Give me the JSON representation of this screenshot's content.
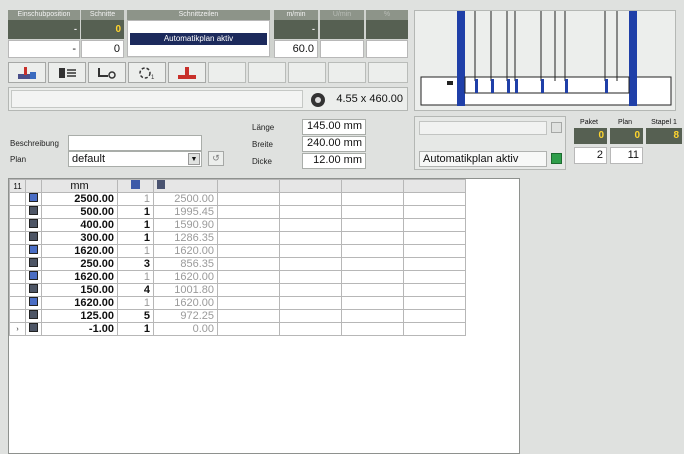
{
  "top_panel": {
    "headers": {
      "einschubposition": "Einschubposition",
      "schnitte": "Schnitte",
      "schnittzeilen": "Schnittzeilen",
      "m_min": "m/min",
      "u_min": "U/min",
      "percent": "%"
    },
    "row1": {
      "einschub": "-",
      "schnitte": "0",
      "schnittzeilen_status": "Automatikplan aktiv",
      "m_min": "-"
    },
    "row2": {
      "einschub": "-",
      "schnitte": "0",
      "m_min": "60.0"
    }
  },
  "toolbar": {
    "buttons": [
      "cut-saw-icon",
      "stack-icon",
      "pusher-icon",
      "rotate-icon",
      "saw-blade-icon"
    ]
  },
  "status_bar": {
    "dimension": "4.55 x 460.00"
  },
  "form": {
    "beschreibung_label": "Beschreibung",
    "beschreibung_value": "",
    "plan_label": "Plan",
    "plan_value": "default",
    "laenge_label": "Länge",
    "laenge_value": "145.00 mm",
    "breite_label": "Breite",
    "breite_value": "240.00 mm",
    "dicke_label": "Dicke",
    "dicke_value": "12.00 mm"
  },
  "right_panel": {
    "status_text": "Automatikplan aktiv",
    "status_color": "#2e9e4a",
    "paket_label": "Paket",
    "plan_label": "Plan",
    "stapel_label": "Stapel 1",
    "paket_top": "0",
    "plan_top": "0",
    "stapel_top": "8",
    "paket_bottom": "2",
    "plan_bottom": "11"
  },
  "table": {
    "header_count": "11",
    "col_mm": "mm",
    "rows": [
      {
        "mm": "2500.00",
        "count": "1",
        "total": "2500.00",
        "count_grey": true
      },
      {
        "mm": "500.00",
        "count": "1",
        "total": "1995.45",
        "count_grey": false
      },
      {
        "mm": "400.00",
        "count": "1",
        "total": "1590.90",
        "count_grey": false
      },
      {
        "mm": "300.00",
        "count": "1",
        "total": "1286.35",
        "count_grey": false
      },
      {
        "mm": "1620.00",
        "count": "1",
        "total": "1620.00",
        "count_grey": true
      },
      {
        "mm": "250.00",
        "count": "3",
        "total": "856.35",
        "count_grey": false
      },
      {
        "mm": "1620.00",
        "count": "1",
        "total": "1620.00",
        "count_grey": true
      },
      {
        "mm": "150.00",
        "count": "4",
        "total": "1001.80",
        "count_grey": false
      },
      {
        "mm": "1620.00",
        "count": "1",
        "total": "1620.00",
        "count_grey": true
      },
      {
        "mm": "125.00",
        "count": "5",
        "total": "972.25",
        "count_grey": false
      },
      {
        "mm": "-1.00",
        "count": "1",
        "total": "0.00",
        "count_grey": false
      }
    ]
  },
  "colors": {
    "dark_cell": "#566052",
    "yellow_value": "#ffd52e",
    "machine_blue": "#1f3fa8",
    "status_navy": "#1c2a5c"
  }
}
